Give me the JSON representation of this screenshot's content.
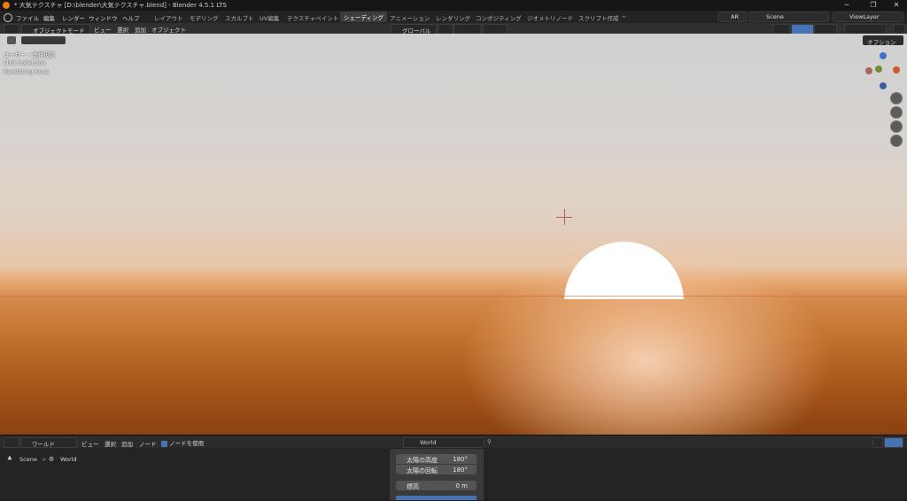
{
  "window": {
    "title": "* 大気テクスチャ [D:\\blender\\大気テクスチャ.blend] - Blender 4.5.1 LTS",
    "minimize": "─",
    "maximize": "❐",
    "close": "✕"
  },
  "menu": [
    "ファイル",
    "編集",
    "レンダー",
    "ウィンドウ",
    "ヘルプ"
  ],
  "workspaces": [
    "レイアウト",
    "モデリング",
    "スカルプト",
    "UV編集",
    "テクスチャペイント",
    "シェーディング",
    "アニメーション",
    "レンダリング",
    "コンポジティング",
    "ジオメトリノード",
    "スクリプト作成"
  ],
  "add_workspace": "+",
  "topright": {
    "ar": "AR",
    "scene": "Scene",
    "viewlayer": "ViewLayer"
  },
  "viewport_header": {
    "mode": "オブジェクトモード",
    "menus": [
      "ビュー",
      "選択",
      "追加",
      "オブジェクト"
    ],
    "transform": "グローバル",
    "options": "オプション"
  },
  "viewport_overlay": {
    "view_name": "ユーザー・透視投影",
    "collection": "(16) Collection",
    "object": "Rendering Sous"
  },
  "node_header": {
    "world_type": "ワールド",
    "menus": [
      "ビュー",
      "選択",
      "追加",
      "ノード"
    ],
    "use_nodes": "ノードを使用",
    "world_name": "World"
  },
  "breadcrumb": {
    "scene": "Scene",
    "separator": ">",
    "world": "World"
  },
  "sky_panel": {
    "sun_elevation_label": "太陽の高度",
    "sun_elevation_value": "180°",
    "sun_rotation_label": "太陽の回転",
    "sun_rotation_value": "180°",
    "altitude_label": "標高",
    "altitude_value": "0 m"
  },
  "colors": {
    "accent": "#4772b3",
    "sun": "#ffffff",
    "sky_top": "#cfd1d0",
    "ground": "#8a4210"
  }
}
